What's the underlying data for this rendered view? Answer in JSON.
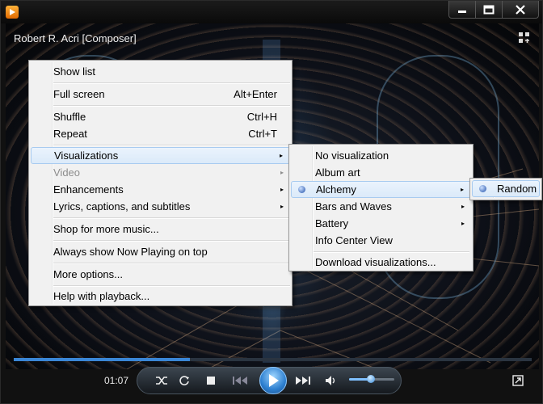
{
  "window": {
    "track_title": "Robert R. Acri [Composer]",
    "controls": {
      "minimize": "—",
      "maximize": "☐",
      "close": "✕"
    }
  },
  "player": {
    "time": "01:07",
    "progress_fraction": 0.34,
    "volume_fraction": 0.48
  },
  "main_menu": [
    {
      "label": "Show list"
    },
    {
      "label": "Full screen",
      "shortcut": "Alt+Enter"
    },
    {
      "label": "Shuffle",
      "shortcut": "Ctrl+H"
    },
    {
      "label": "Repeat",
      "shortcut": "Ctrl+T"
    },
    {
      "label": "Visualizations",
      "submenu": true,
      "state": "highlighted"
    },
    {
      "label": "Video",
      "submenu": true,
      "state": "disabled"
    },
    {
      "label": "Enhancements",
      "submenu": true
    },
    {
      "label": "Lyrics, captions, and subtitles",
      "submenu": true
    },
    {
      "label": "Shop for more music..."
    },
    {
      "label": "Always show Now Playing on top"
    },
    {
      "label": "More options..."
    },
    {
      "label": "Help with playback..."
    }
  ],
  "visualizations_menu": [
    {
      "label": "No visualization"
    },
    {
      "label": "Album art"
    },
    {
      "label": "Alchemy",
      "submenu": true,
      "state": "highlighted",
      "selected": true
    },
    {
      "label": "Bars and Waves",
      "submenu": true
    },
    {
      "label": "Battery",
      "submenu": true
    },
    {
      "label": "Info Center View"
    },
    {
      "label": "Download visualizations..."
    }
  ],
  "alchemy_menu": [
    {
      "label": "Random",
      "selected": true
    }
  ],
  "icons": {
    "app": "media-player-icon",
    "arrow": "▸",
    "accent": "#3a86d6"
  }
}
